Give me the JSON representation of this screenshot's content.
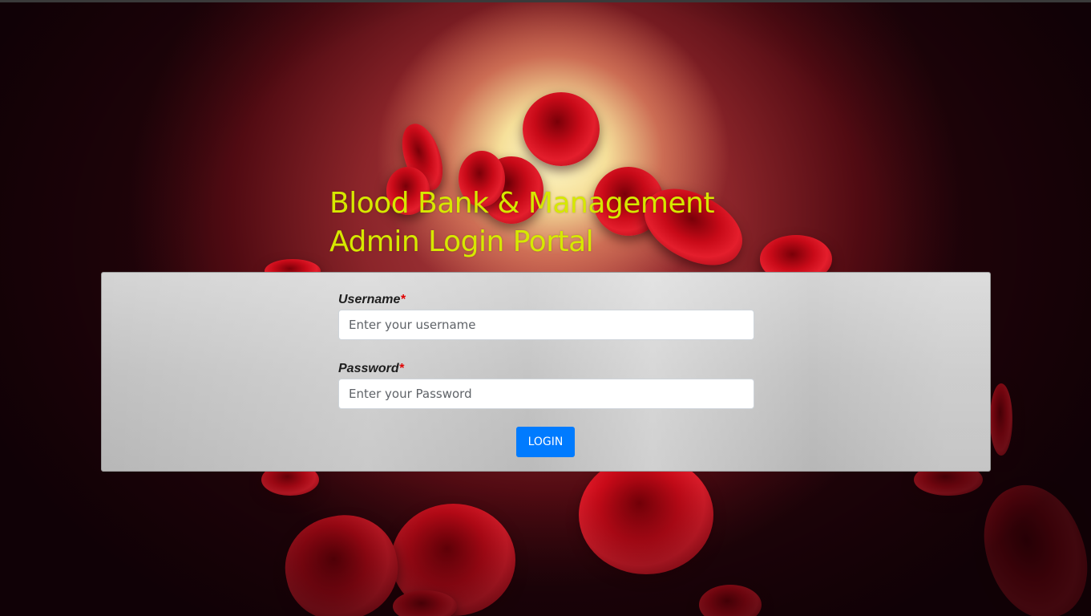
{
  "header": {
    "title_line1": "Blood Bank & Management",
    "title_line2": "Admin Login Portal"
  },
  "form": {
    "username": {
      "label": "Username",
      "required_mark": "*",
      "placeholder": "Enter your username",
      "value": ""
    },
    "password": {
      "label": "Password",
      "required_mark": "*",
      "placeholder": "Enter your Password",
      "value": ""
    },
    "login_label": "LOGIN"
  },
  "colors": {
    "title": "#d6e800",
    "required": "#e00000",
    "button": "#007bff",
    "panel": "#c4c4c4"
  }
}
